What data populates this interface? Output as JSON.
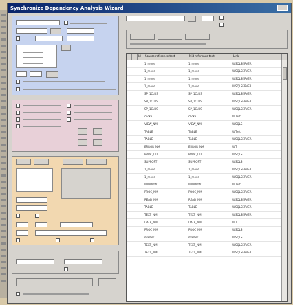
{
  "window": {
    "title": "Synchronize Dependency Analysis Wizard"
  },
  "colors": {
    "titlebar": "#0a246a",
    "panel_blue": "#c6d3ef",
    "panel_peach": "#f2d8b0",
    "panel_pink": "#e8d0d8"
  },
  "icons": [
    "close-icon",
    "checkbox-icon",
    "scrollbar-icon"
  ],
  "grid": {
    "columns": [
      "",
      "",
      "Id",
      "Source reference text",
      "Mid reference text",
      "Link"
    ],
    "rows": [
      [
        "1_move",
        "1_move",
        "WSQLSERVER"
      ],
      [
        "1_move",
        "1_move",
        "WSQLSERVER"
      ],
      [
        "1_move",
        "1_move",
        "WSQLSERVER"
      ],
      [
        "1_move",
        "1_move",
        "WSQLSERVER"
      ],
      [
        "SP_1CLUS",
        "SP_1CLUS",
        "WSQLSERVER"
      ],
      [
        "SP_1CLUS",
        "SP_1CLUS",
        "WSQLSERVER"
      ],
      [
        "SP_1CLUS",
        "SP_1CLUS",
        "WSQLSERVER"
      ],
      [
        "clicke",
        "clicke",
        "WTest"
      ],
      [
        "VIEW_NM",
        "VIEW_NM",
        "WSQLS"
      ],
      [
        "TABLE",
        "TABLE",
        "WTest"
      ],
      [
        "TABLE",
        "TABLE",
        "WSQLSERVER"
      ],
      [
        "ERROR_NM",
        "ERROR_NM",
        "WT"
      ],
      [
        "PROC_DIT",
        "PROC_DIT",
        "WSQLS"
      ],
      [
        "SUPPORT",
        "SUPPORT",
        "WSQLS"
      ],
      [
        "1_move",
        "1_move",
        "WSQLSERVER"
      ],
      [
        "1_move",
        "1_move",
        "WSQLSERVER"
      ],
      [
        "WINDOW",
        "WINDOW",
        "WTest"
      ],
      [
        "PROC_NM",
        "PROC_NM",
        "WSQLSERVER"
      ],
      [
        "READ_NM",
        "READ_NM",
        "WSQLSERVER"
      ],
      [
        "TABLE",
        "TABLE",
        "WSQLSERVER"
      ],
      [
        "TEXT_NM",
        "TEXT_NM",
        "WSQLSERVER"
      ],
      [
        "DATA_NM",
        "DATA_NM",
        "WT"
      ],
      [
        "PROC_NM",
        "PROC_NM",
        "WSQLS"
      ],
      [
        "master",
        "master",
        "WSQLS"
      ],
      [
        "TEXT_NM",
        "TEXT_NM",
        "WSQLSERVER"
      ],
      [
        "TEXT_NM",
        "TEXT_NM",
        "WSQLSERVER"
      ]
    ]
  }
}
